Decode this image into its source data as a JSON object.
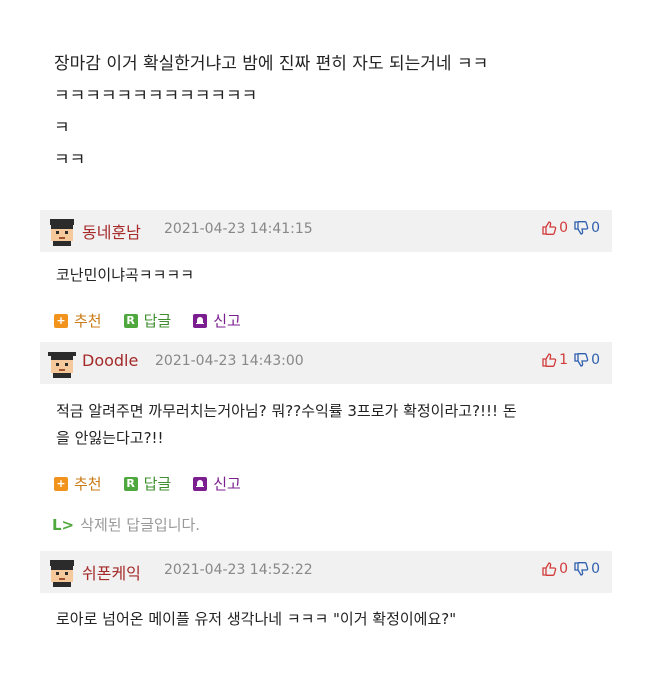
{
  "post": {
    "lines": [
      "장마감 이거 확실한거냐고 밤에 진짜 편히 자도 되는거네 ㅋㅋ",
      "ㅋㅋㅋㅋㅋㅋㅋㅋㅋㅋㅋㅋㅋ",
      "ㅋ",
      "ㅋㅋ"
    ]
  },
  "comments": [
    {
      "nickname": "동네훈남",
      "date": "2021-04-23 14:41:15",
      "up": "0",
      "down": "0",
      "text": "코난민이냐곡ㅋㅋㅋㅋ"
    },
    {
      "nickname": "Doodle",
      "date": "2021-04-23 14:43:00",
      "up": "1",
      "down": "0",
      "text_lines": [
        "적금 알려주면 까무러치는거아님? 뭐??수익률 3프로가 확정이라고?!!! 돈",
        "을 안잃는다고?!!"
      ]
    },
    {
      "nickname": "쉬폰케익",
      "date": "2021-04-23 14:52:22",
      "up": "0",
      "down": "0",
      "text": "로아로 넘어온 메이플 유저 생각나네 ㅋㅋㅋ \"이거 확정이에요?\""
    }
  ],
  "actions": {
    "recommend_badge": "+",
    "recommend": "추천",
    "reply_badge": "R",
    "reply": "답글",
    "report": "신고"
  },
  "deleted_reply": {
    "arrow": "L>",
    "text": "삭제된 답글입니다."
  },
  "colors": {
    "nickname": "#a52a2a",
    "up": "#d23b3b",
    "down": "#2f5fae",
    "header_bg": "#f1f1f1"
  }
}
